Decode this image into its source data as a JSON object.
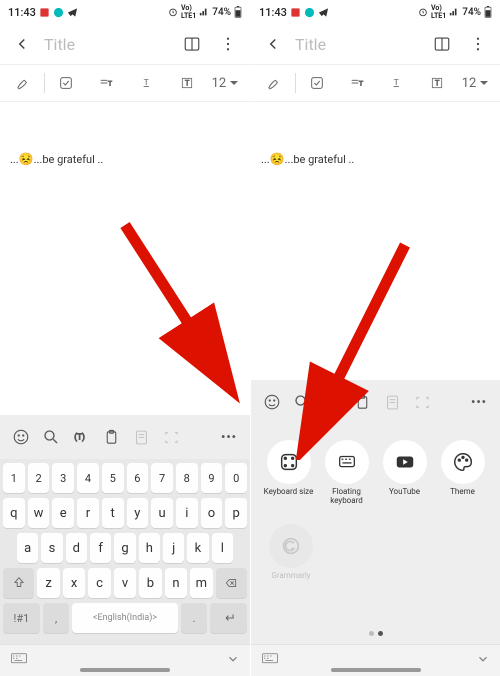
{
  "status": {
    "time": "11:43",
    "battery": "74%"
  },
  "header": {
    "title_placeholder": "Title"
  },
  "toolbar": {
    "fontsize": "12"
  },
  "note_content": {
    "prefix": "...",
    "emoji": "😣",
    "text": "...be grateful .."
  },
  "keyboard": {
    "row_num": [
      "1",
      "2",
      "3",
      "4",
      "5",
      "6",
      "7",
      "8",
      "9",
      "0"
    ],
    "row_q": [
      "q",
      "w",
      "e",
      "r",
      "t",
      "y",
      "u",
      "i",
      "o",
      "p"
    ],
    "row_a": [
      "a",
      "s",
      "d",
      "f",
      "g",
      "h",
      "j",
      "k",
      "l"
    ],
    "row_z": [
      "z",
      "x",
      "c",
      "v",
      "b",
      "n",
      "m"
    ],
    "sym": "!#1",
    "comma": ",",
    "space": "English(India)",
    "dot": "."
  },
  "kb_options": {
    "keyboard_size": "Keyboard size",
    "floating": "Floating keyboard",
    "youtube": "YouTube",
    "theme": "Theme",
    "grammarly": "Grammarly"
  }
}
